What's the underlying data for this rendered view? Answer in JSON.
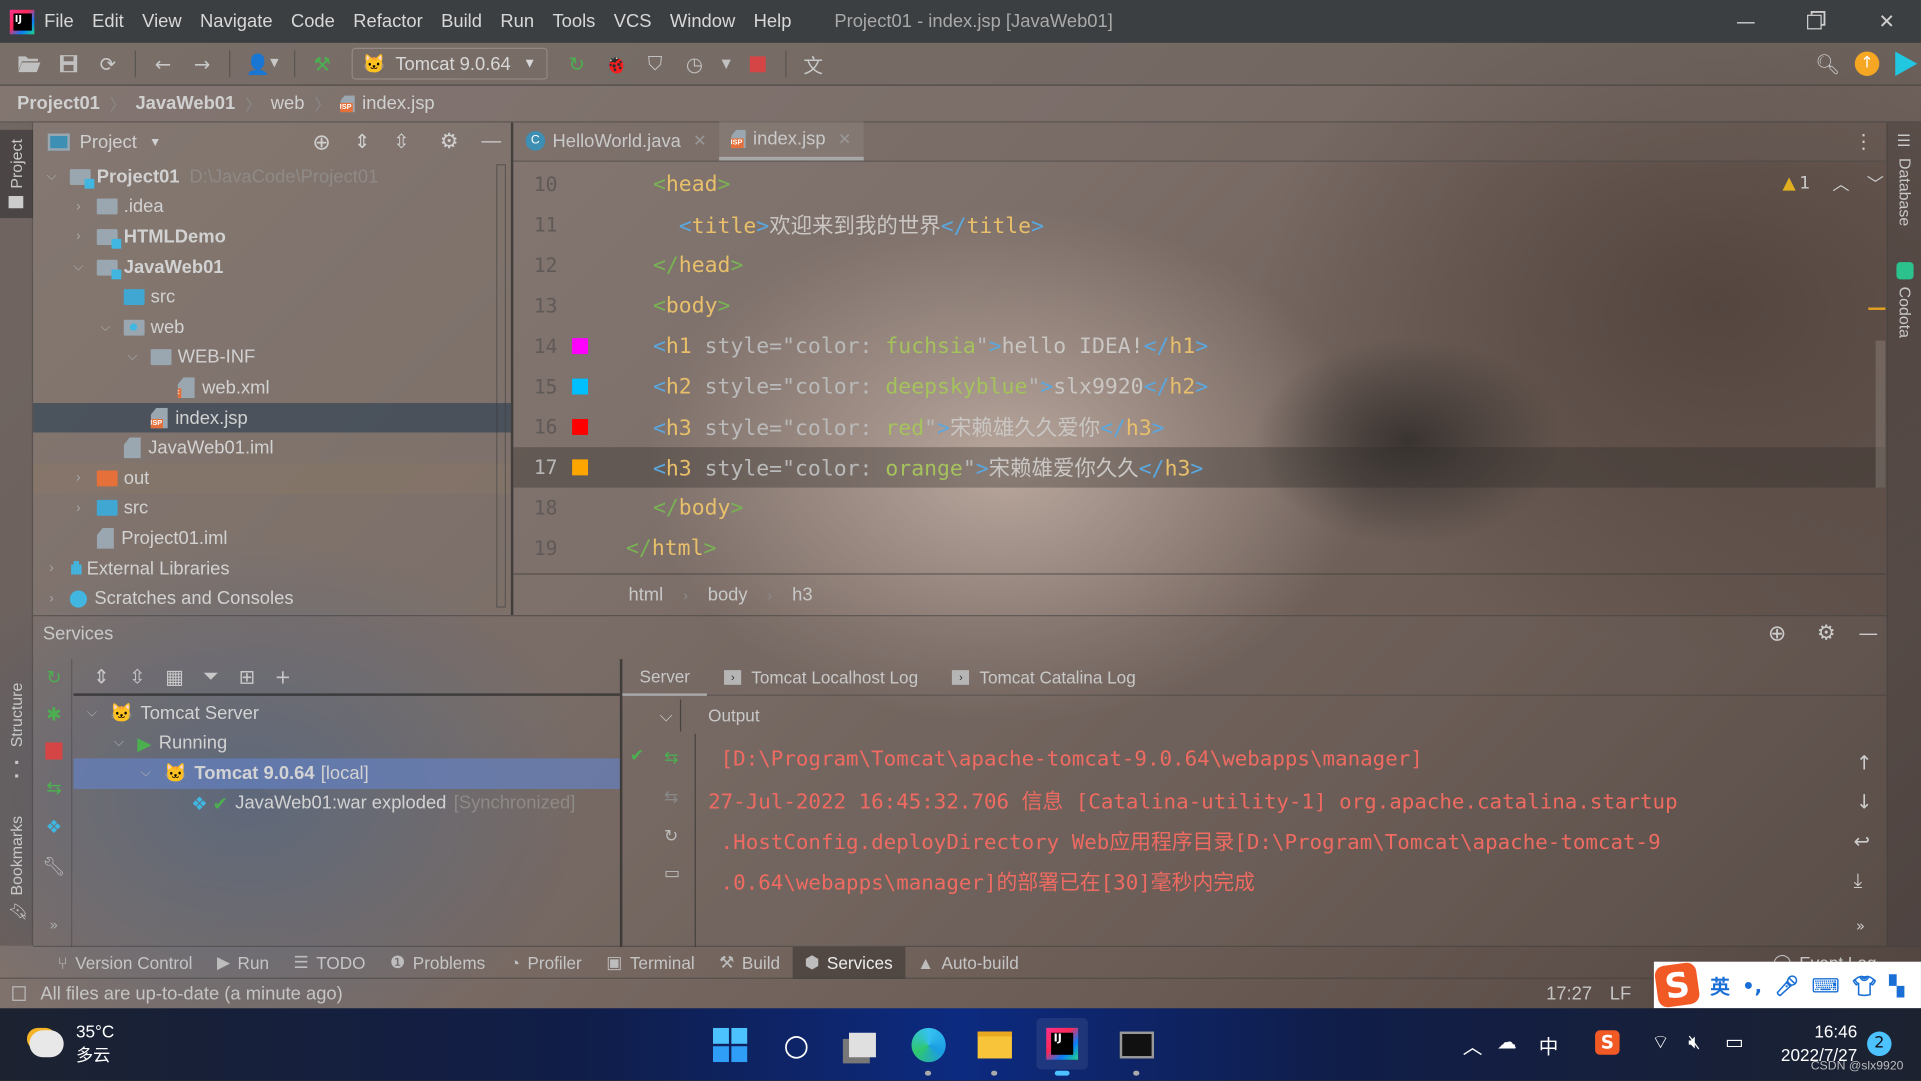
{
  "window": {
    "title": "Project01 - index.jsp [JavaWeb01]",
    "menu": [
      "File",
      "Edit",
      "View",
      "Navigate",
      "Code",
      "Refactor",
      "Build",
      "Run",
      "Tools",
      "VCS",
      "Window",
      "Help"
    ]
  },
  "toolbar": {
    "run_config": "Tomcat 9.0.64"
  },
  "breadcrumb": [
    "Project01",
    "JavaWeb01",
    "web",
    "index.jsp"
  ],
  "left_stripe": {
    "project": "Project",
    "structure": "Structure",
    "bookmarks": "Bookmarks"
  },
  "right_stripe": {
    "database": "Database",
    "codota": "Codota"
  },
  "project_panel": {
    "header": "Project",
    "tree": [
      {
        "label": "Project01",
        "hint": "D:\\JavaCode\\Project01"
      },
      {
        "label": ".idea"
      },
      {
        "label": "HTMLDemo"
      },
      {
        "label": "JavaWeb01"
      },
      {
        "label": "src"
      },
      {
        "label": "web"
      },
      {
        "label": "WEB-INF"
      },
      {
        "label": "web.xml"
      },
      {
        "label": "index.jsp"
      },
      {
        "label": "JavaWeb01.iml"
      },
      {
        "label": "out"
      },
      {
        "label": "src"
      },
      {
        "label": "Project01.iml"
      },
      {
        "label": "External Libraries"
      },
      {
        "label": "Scratches and Consoles"
      }
    ]
  },
  "editor": {
    "tabs": [
      {
        "label": "HelloWorld.java",
        "active": false
      },
      {
        "label": "index.jsp",
        "active": true
      }
    ],
    "inspection": {
      "warnings": "1"
    },
    "lines": [
      {
        "num": "10",
        "indent": "",
        "tokens": [
          [
            "c-tagg",
            "<"
          ],
          [
            "c-tag",
            "head"
          ],
          [
            "c-tagg",
            ">"
          ]
        ]
      },
      {
        "num": "11",
        "indent": "  ",
        "tokens": [
          [
            "c-br",
            "<"
          ],
          [
            "c-tag",
            "title"
          ],
          [
            "c-br",
            ">"
          ],
          [
            "c-txt",
            "欢迎来到我的世界"
          ],
          [
            "c-br",
            "</"
          ],
          [
            "c-tag",
            "title"
          ],
          [
            "c-br",
            ">"
          ]
        ]
      },
      {
        "num": "12",
        "indent": "",
        "tokens": [
          [
            "c-tagg",
            "</"
          ],
          [
            "c-tag",
            "head"
          ],
          [
            "c-tagg",
            ">"
          ]
        ]
      },
      {
        "num": "13",
        "indent": "",
        "tokens": [
          [
            "c-tagg",
            "<"
          ],
          [
            "c-tag",
            "body"
          ],
          [
            "c-tagg",
            ">"
          ]
        ]
      },
      {
        "num": "14",
        "indent": "",
        "swatch": "#ff00ff",
        "tokens": [
          [
            "c-br",
            "<"
          ],
          [
            "c-tag",
            "h1"
          ],
          [
            "c-attr",
            " style="
          ],
          [
            "c-attr",
            "\""
          ],
          [
            "c-attr",
            "color: "
          ],
          [
            "c-val",
            "fuchsia"
          ],
          [
            "c-attr",
            "\""
          ],
          [
            "c-br",
            ">"
          ],
          [
            "c-txt",
            "hello IDEA!"
          ],
          [
            "c-br",
            "</"
          ],
          [
            "c-tag",
            "h1"
          ],
          [
            "c-br",
            ">"
          ]
        ]
      },
      {
        "num": "15",
        "indent": "",
        "swatch": "#00bfff",
        "tokens": [
          [
            "c-br",
            "<"
          ],
          [
            "c-tag",
            "h2"
          ],
          [
            "c-attr",
            " style="
          ],
          [
            "c-attr",
            "\""
          ],
          [
            "c-attr",
            "color: "
          ],
          [
            "c-val",
            "deepskyblue"
          ],
          [
            "c-attr",
            "\""
          ],
          [
            "c-br",
            ">"
          ],
          [
            "c-txt",
            "slx9920"
          ],
          [
            "c-br",
            "</"
          ],
          [
            "c-tag",
            "h2"
          ],
          [
            "c-br",
            ">"
          ]
        ]
      },
      {
        "num": "16",
        "indent": "",
        "swatch": "#ff0000",
        "tokens": [
          [
            "c-br",
            "<"
          ],
          [
            "c-tag",
            "h3"
          ],
          [
            "c-attr",
            " style="
          ],
          [
            "c-attr",
            "\""
          ],
          [
            "c-attr",
            "color: "
          ],
          [
            "c-val",
            "red"
          ],
          [
            "c-attr",
            "\""
          ],
          [
            "c-br",
            ">"
          ],
          [
            "c-txt",
            "宋赖雄久久爱你"
          ],
          [
            "c-br",
            "</"
          ],
          [
            "c-tag",
            "h3"
          ],
          [
            "c-br",
            ">"
          ]
        ]
      },
      {
        "num": "17",
        "indent": "",
        "swatch": "#ffa500",
        "current": true,
        "tokens": [
          [
            "c-br",
            "<"
          ],
          [
            "c-tag",
            "h3"
          ],
          [
            "c-attr",
            " style="
          ],
          [
            "c-attr",
            "\""
          ],
          [
            "c-attr",
            "color: "
          ],
          [
            "c-val",
            "orange"
          ],
          [
            "c-attr",
            "\""
          ],
          [
            "c-br",
            ">"
          ],
          [
            "c-txt",
            "宋赖雄爱你久久"
          ],
          [
            "c-br",
            "</"
          ],
          [
            "c-tag",
            "h3"
          ],
          [
            "c-br",
            ">"
          ]
        ]
      },
      {
        "num": "18",
        "indent": "",
        "tokens": [
          [
            "c-tagg",
            "</"
          ],
          [
            "c-tag",
            "body"
          ],
          [
            "c-tagg",
            ">"
          ]
        ]
      },
      {
        "num": "19",
        "indent": "",
        "outdent": true,
        "tokens": [
          [
            "c-tagg",
            "</"
          ],
          [
            "c-tag",
            "html"
          ],
          [
            "c-tagg",
            ">"
          ]
        ]
      }
    ],
    "crumbs": [
      "html",
      "body",
      "h3"
    ]
  },
  "services": {
    "title": "Services",
    "tree": [
      {
        "label": "Tomcat Server"
      },
      {
        "label": "Running"
      },
      {
        "label": "Tomcat 9.0.64",
        "suffix": "[local]"
      },
      {
        "label": "JavaWeb01:war exploded",
        "suffix": "[Synchronized]"
      }
    ],
    "tabs": [
      "Server",
      "Tomcat Localhost Log",
      "Tomcat Catalina Log"
    ],
    "output_label": "Output",
    "log": [
      " [D:\\Program\\Tomcat\\apache-tomcat-9.0.64\\webapps\\manager]",
      "27-Jul-2022 16:45:32.706 信息 [Catalina-utility-1] org.apache.catalina.startup",
      " .HostConfig.deployDirectory Web应用程序目录[D:\\Program\\Tomcat\\apache-tomcat-9",
      " .0.64\\webapps\\manager]的部署已在[30]毫秒内完成"
    ]
  },
  "tool_tabs": [
    {
      "label": "Version Control",
      "icon": "⑂"
    },
    {
      "label": "Run",
      "icon": "▶"
    },
    {
      "label": "TODO",
      "icon": "☰"
    },
    {
      "label": "Problems",
      "icon": "❶"
    },
    {
      "label": "Profiler",
      "icon": "◔"
    },
    {
      "label": "Terminal",
      "icon": "▣"
    },
    {
      "label": "Build",
      "icon": "⚒"
    },
    {
      "label": "Services",
      "icon": "⬢",
      "active": true
    },
    {
      "label": "Auto-build",
      "icon": "▲"
    }
  ],
  "event_log": "Event Log",
  "status": {
    "message": "All files are up-to-date (a minute ago)",
    "position": "17:27",
    "line_sep": "LF"
  },
  "ime": {
    "mode": "英"
  },
  "taskbar": {
    "weather_temp": "35°C",
    "weather_desc": "多云",
    "lang": "中",
    "time": "16:46",
    "date": "2022/7/27",
    "notifications": "2",
    "watermark": "CSDN @slx9920"
  }
}
